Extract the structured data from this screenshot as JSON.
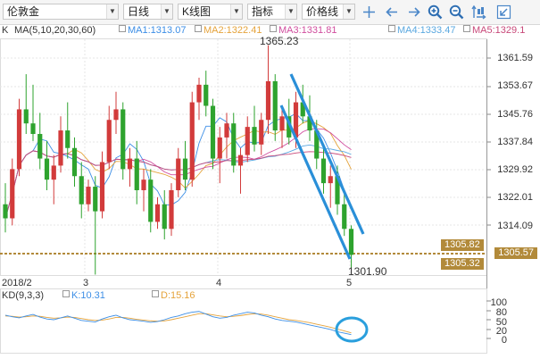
{
  "toolbar": {
    "symbol": "伦敦金",
    "period": "日线",
    "chart_type": "K线图",
    "indicator": "指标",
    "price_line": "价格线",
    "icons": [
      "crosshair-icon",
      "arrow-left-icon",
      "arrow-right-icon",
      "zoom-in-icon",
      "zoom-out-icon",
      "compare-icon",
      "minimize-icon"
    ]
  },
  "ma_legend": {
    "k": "K",
    "params": "MA(5,10,20,30,60)",
    "ma1": "MA1:1313.07",
    "ma2": "MA2:1322.41",
    "ma3": "MA3:1331.81",
    "ma4": "MA4:1333.47",
    "ma5": "MA5:1329.1"
  },
  "price_axis": [
    "1361.59",
    "1353.67",
    "1345.76",
    "1337.84",
    "1329.92",
    "1322.01",
    "1314.09"
  ],
  "tags": {
    "a": "1305.82",
    "b": "1305.57",
    "c": "1305.32"
  },
  "annotations": {
    "high": "1365.23",
    "low": "1301.90"
  },
  "x_axis": [
    "2018/2",
    "3",
    "4",
    "5"
  ],
  "kd": {
    "params": "KD(9,3,3)",
    "k": "K:10.31",
    "d": "D:15.16",
    "axis": [
      "100",
      "80",
      "50",
      "20",
      "0"
    ]
  },
  "colors": {
    "up": "#d23b3b",
    "down": "#2ea32e",
    "ma1": "#3c8ee6",
    "ma2": "#e5a33b",
    "ma3": "#d04d9e",
    "ma4": "#5aa8e0",
    "ma5": "#c8497a",
    "trend": "#2a8fd8",
    "accent": "#b28a3a"
  }
}
